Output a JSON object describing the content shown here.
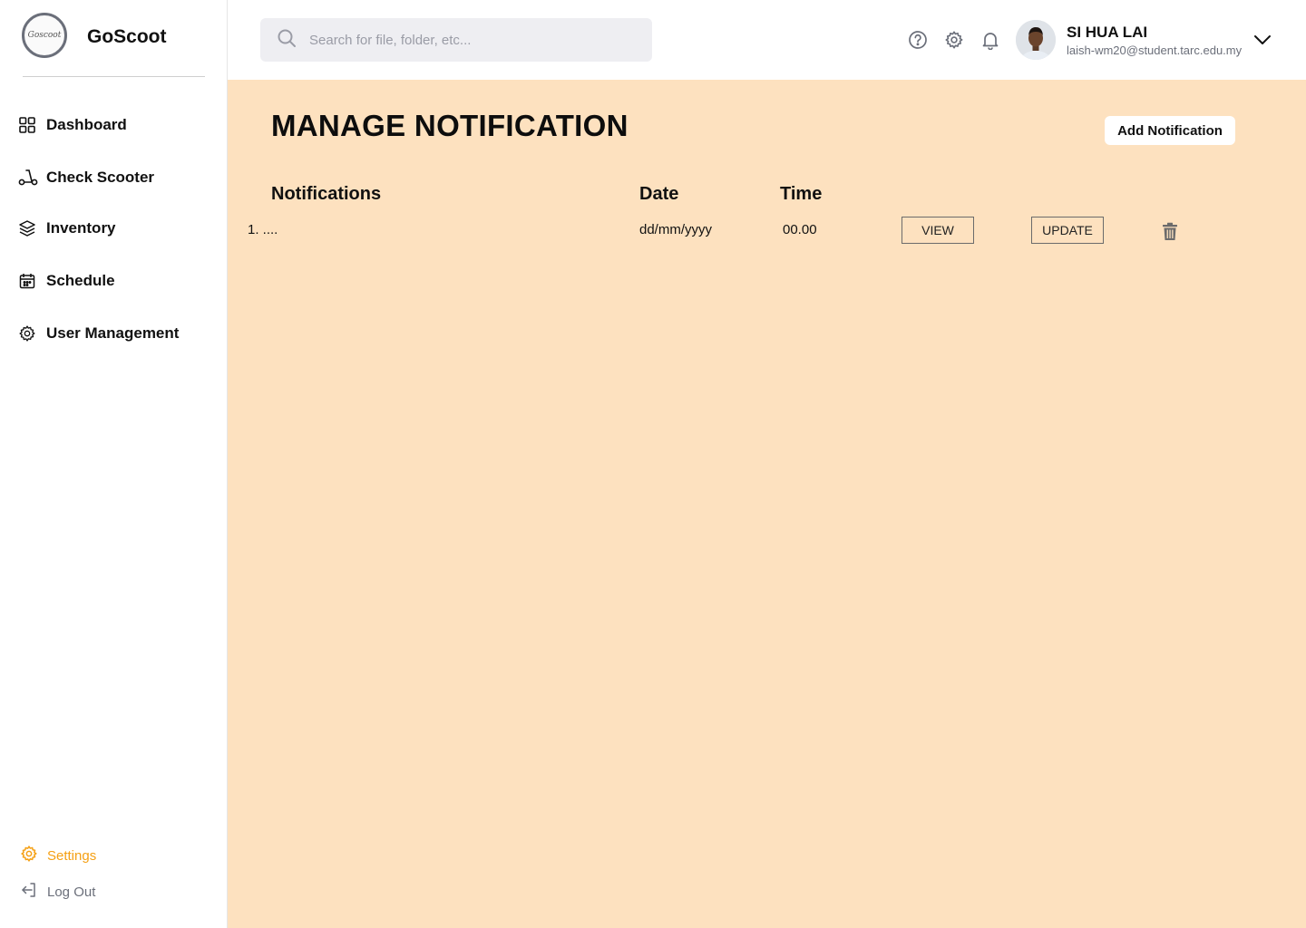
{
  "brand": {
    "logo_text": "Goscoot",
    "name": "GoScoot"
  },
  "sidebar": {
    "items": [
      {
        "label": "Dashboard",
        "icon": "grid-icon"
      },
      {
        "label": "Check Scooter",
        "icon": "scooter-icon"
      },
      {
        "label": "Inventory",
        "icon": "box-icon"
      },
      {
        "label": "Schedule",
        "icon": "calendar-icon"
      },
      {
        "label": "User Management",
        "icon": "gear-icon"
      }
    ],
    "settings_label": "Settings",
    "logout_label": "Log Out"
  },
  "header": {
    "search_placeholder": "Search for file, folder, etc...",
    "user_name": "SI HUA LAI",
    "user_email": "laish-wm20@student.tarc.edu.my"
  },
  "main": {
    "title": "MANAGE NOTIFICATION",
    "add_button": "Add Notification",
    "columns": {
      "notifications": "Notifications",
      "date": "Date",
      "time": "Time"
    },
    "rows": [
      {
        "notification": "1. ....",
        "date": "dd/mm/yyyy",
        "time": "00.00",
        "view_label": "VIEW",
        "update_label": "UPDATE"
      }
    ]
  },
  "colors": {
    "main_bg": "#fde1bf",
    "accent": "#f5a014",
    "muted": "#6b6f7a"
  }
}
